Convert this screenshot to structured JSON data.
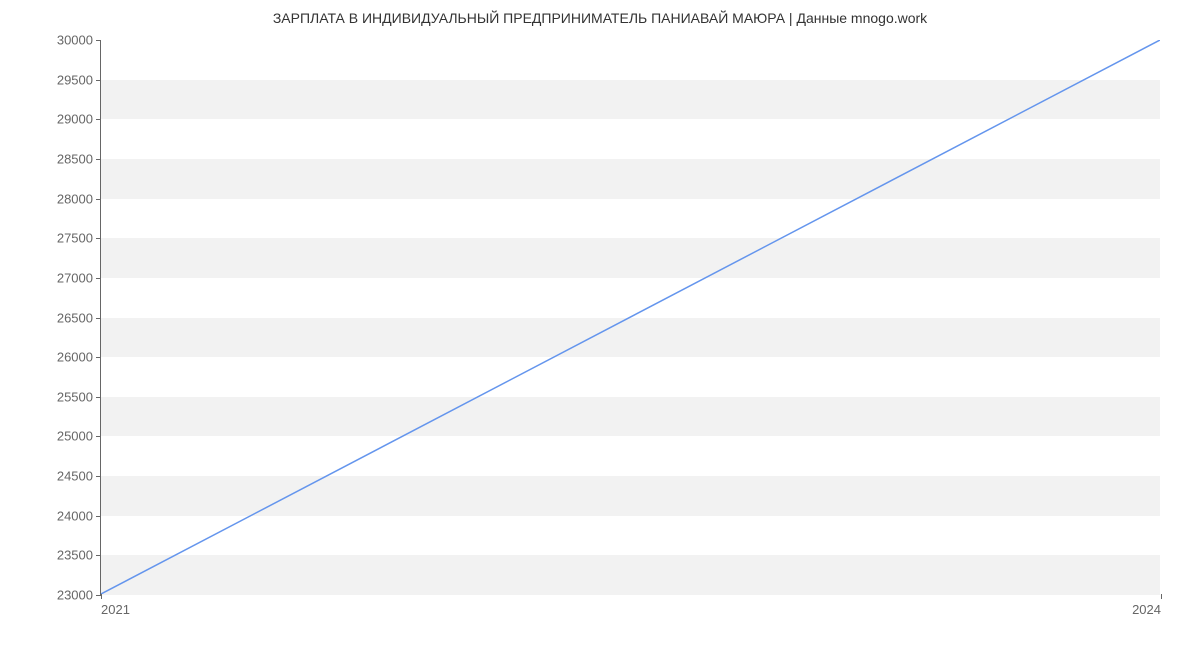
{
  "chart_data": {
    "type": "line",
    "title": "ЗАРПЛАТА В ИНДИВИДУАЛЬНЫЙ ПРЕДПРИНИМАТЕЛЬ ПАНИАВАЙ МАЮРА | Данные mnogo.work",
    "x": [
      2021,
      2024
    ],
    "values": [
      23000,
      30000
    ],
    "xlabel": "",
    "ylabel": "",
    "xlim": [
      2021,
      2024
    ],
    "ylim": [
      23000,
      30000
    ],
    "x_ticks": [
      2021,
      2024
    ],
    "y_ticks": [
      23000,
      23500,
      24000,
      24500,
      25000,
      25500,
      26000,
      26500,
      27000,
      27500,
      28000,
      28500,
      29000,
      29500,
      30000
    ],
    "line_color": "#6495ed",
    "band_color": "#f2f2f2"
  }
}
